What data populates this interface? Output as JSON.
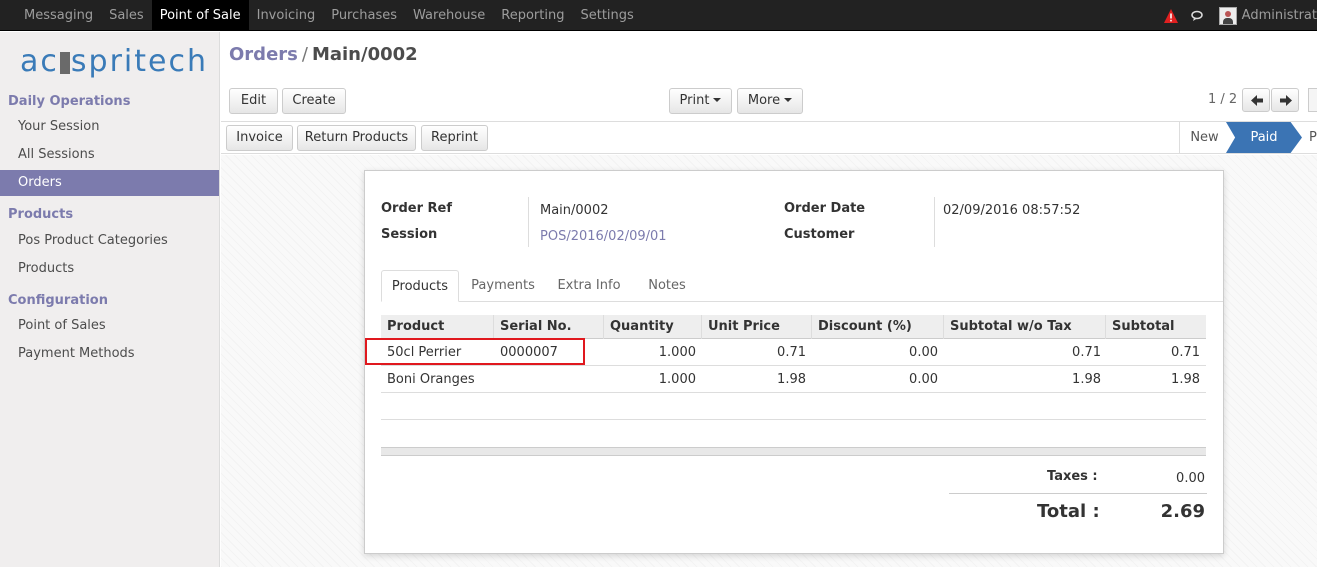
{
  "topbar": {
    "menu": [
      "Messaging",
      "Sales",
      "Point of Sale",
      "Invoicing",
      "Purchases",
      "Warehouse",
      "Reporting",
      "Settings"
    ],
    "active_index": 2,
    "user_name": "Administrat"
  },
  "sidebar": {
    "logo_text_left": "ac",
    "logo_text_right": "spritech",
    "sections": [
      {
        "title": "Daily Operations",
        "items": [
          "Your Session",
          "All Sessions",
          "Orders"
        ]
      },
      {
        "title": "Products",
        "items": [
          "Pos Product Categories",
          "Products"
        ]
      },
      {
        "title": "Configuration",
        "items": [
          "Point of Sales",
          "Payment Methods"
        ]
      }
    ],
    "active_item": "Orders"
  },
  "breadcrumb": {
    "parent": "Orders",
    "separator": "/",
    "current": "Main/0002"
  },
  "buttons": {
    "edit": "Edit",
    "create": "Create",
    "print": "Print",
    "more": "More",
    "invoice": "Invoice",
    "return_products": "Return Products",
    "reprint": "Reprint"
  },
  "pager": {
    "text": "1 / 2"
  },
  "statusbar": {
    "stages": [
      "New",
      "Paid",
      "P"
    ],
    "active": "Paid"
  },
  "form": {
    "order_ref_label": "Order Ref",
    "order_ref": "Main/0002",
    "session_label": "Session",
    "session": "POS/2016/02/09/01",
    "order_date_label": "Order Date",
    "order_date": "02/09/2016 08:57:52",
    "customer_label": "Customer",
    "customer": ""
  },
  "tabs": [
    "Products",
    "Payments",
    "Extra Info",
    "Notes"
  ],
  "active_tab": "Products",
  "table": {
    "columns": [
      "Product",
      "Serial No.",
      "Quantity",
      "Unit Price",
      "Discount (%)",
      "Subtotal w/o Tax",
      "Subtotal"
    ],
    "rows": [
      {
        "product": "50cl Perrier",
        "serial": "0000007",
        "quantity": "1.000",
        "unit_price": "0.71",
        "discount": "0.00",
        "subtotal_wo_tax": "0.71",
        "subtotal": "0.71"
      },
      {
        "product": "Boni Oranges",
        "serial": "",
        "quantity": "1.000",
        "unit_price": "1.98",
        "discount": "0.00",
        "subtotal_wo_tax": "1.98",
        "subtotal": "1.98"
      }
    ]
  },
  "totals": {
    "taxes_label": "Taxes :",
    "taxes": "0.00",
    "total_label": "Total :",
    "total": "2.69"
  },
  "colors": {
    "accent": "#7c7bad",
    "stage_active": "#3b74b4",
    "highlight": "#e0181e",
    "topbar": "#222222"
  }
}
